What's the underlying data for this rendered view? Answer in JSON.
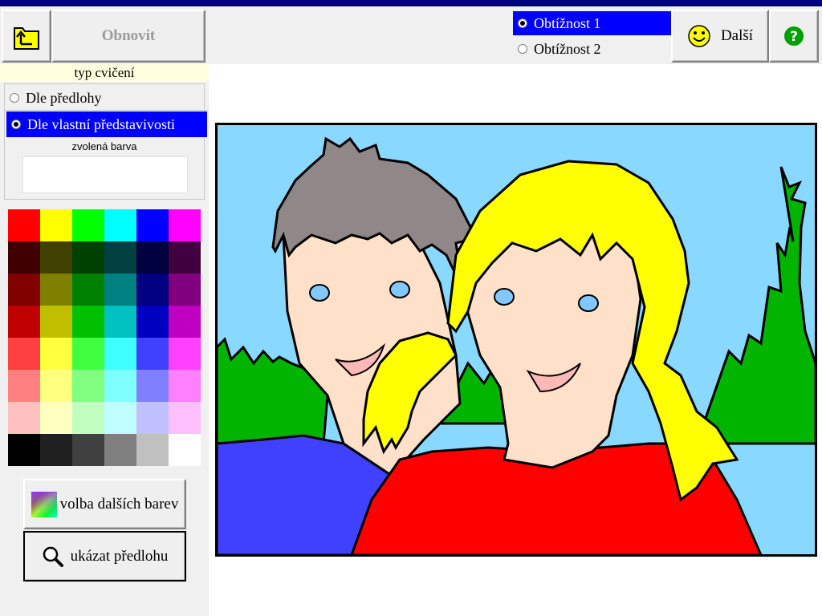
{
  "toolbar": {
    "open_icon": "folder-up-icon",
    "refresh_label": "Obnovit",
    "difficulty": [
      {
        "label": "Obtížnost 1",
        "selected": true
      },
      {
        "label": "Obtížnost 2",
        "selected": false
      }
    ],
    "next_label": "Další",
    "next_icon": "smiley-icon",
    "help_icon": "question-icon"
  },
  "left_panel": {
    "exercise_type_title": "typ cvičení",
    "exercise_types": [
      {
        "label": "Dle předlohy",
        "selected": false
      },
      {
        "label": "Dle vlastní představivosti",
        "selected": true
      }
    ],
    "chosen_color_label": "zvolená barva",
    "chosen_color": "#ffffff",
    "palette": [
      [
        "#ff0000",
        "#ffff00",
        "#00ff00",
        "#00ffff",
        "#0000ff",
        "#ff00ff"
      ],
      [
        "#400000",
        "#404000",
        "#004000",
        "#004040",
        "#000040",
        "#400040"
      ],
      [
        "#800000",
        "#808000",
        "#008000",
        "#008080",
        "#000080",
        "#800080"
      ],
      [
        "#c00000",
        "#c0c000",
        "#00c000",
        "#00c0c0",
        "#0000c0",
        "#c000c0"
      ],
      [
        "#ff4040",
        "#ffff40",
        "#40ff40",
        "#40ffff",
        "#4040ff",
        "#ff40ff"
      ],
      [
        "#ff8080",
        "#ffff80",
        "#80ff80",
        "#80ffff",
        "#8080ff",
        "#ff80ff"
      ],
      [
        "#ffc0c0",
        "#ffffc0",
        "#c0ffc0",
        "#c0ffff",
        "#c0c0ff",
        "#ffc0ff"
      ],
      [
        "#000000",
        "#202020",
        "#404040",
        "#808080",
        "#c0c0c0",
        "#ffffff"
      ]
    ],
    "more_colors_label": "volba dalších barev",
    "more_colors_icon": "color-gradient-icon",
    "show_template_label": "ukázat předlohu",
    "show_template_icon": "magnifier-icon"
  },
  "canvas": {
    "sky": "#88d8ff",
    "bush": "#00b400",
    "boy_hair": "#908888",
    "girl_hair": "#ffff00",
    "skin": "#ffe0c8",
    "boy_shirt": "#4040ff",
    "girl_shirt": "#ff0000",
    "eyes": "#80c8ff",
    "mouth": "#ffb8b8"
  }
}
